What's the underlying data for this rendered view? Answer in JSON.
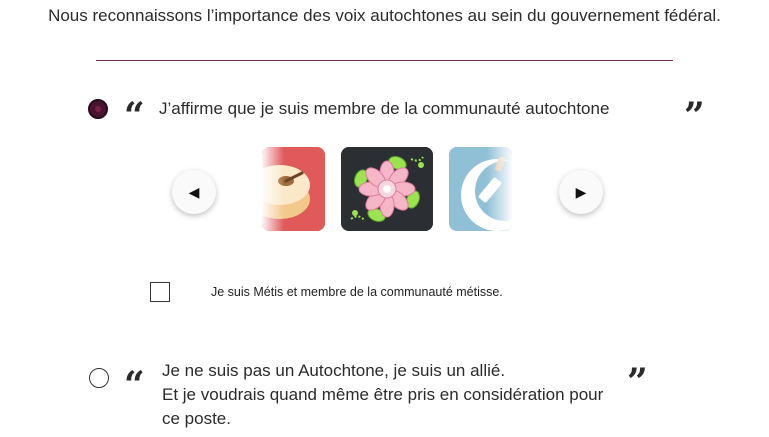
{
  "intro_text": "Nous reconnaissons l’importance des voix autochtones au sein du gouvernement fédéral.",
  "option1": {
    "selected": true,
    "text": "J’affirme que je suis membre de la communauté autochtone",
    "open_quote": "“",
    "close_quote": "”"
  },
  "carousel": {
    "prev_icon": "◀",
    "next_icon": "▶",
    "cards": [
      {
        "name": "drum-card",
        "color": "#e05a5a"
      },
      {
        "name": "floral-beadwork-card",
        "color": "#2b2f33"
      },
      {
        "name": "moon-pipe-card",
        "color": "#8fc0d6"
      }
    ]
  },
  "metis": {
    "checked": false,
    "label": "Je suis Métis et membre de la communauté métisse."
  },
  "option2": {
    "selected": false,
    "line1": "Je ne suis pas un Autochtone, je suis un allié.",
    "line2": "Et je voudrais quand même être pris en considération pour",
    "line3": "ce poste.",
    "open_quote": "“",
    "close_quote": "”"
  }
}
